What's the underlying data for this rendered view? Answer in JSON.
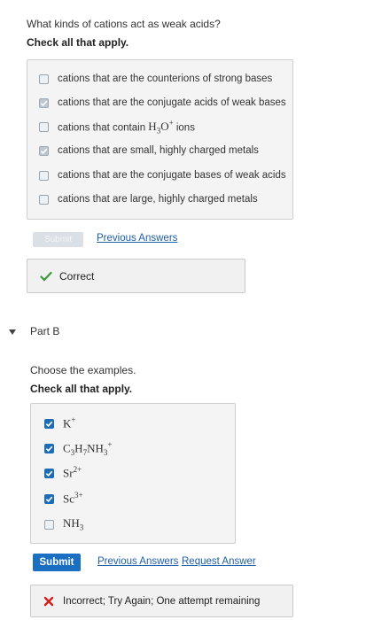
{
  "part_a": {
    "question": "What kinds of cations act as weak acids?",
    "instruction": "Check all that apply.",
    "options": [
      {
        "label": "cations that are the counterions of strong bases",
        "checked": false
      },
      {
        "label": "cations that are the conjugate acids of weak bases",
        "checked": true
      },
      {
        "label_prefix": "cations that contain ",
        "label_formula_main": "H",
        "label_formula_sub": "3",
        "label_formula_main2": "O",
        "label_formula_sup": "+",
        "label_suffix": " ions",
        "checked": false
      },
      {
        "label": "cations that are small, highly charged metals",
        "checked": true
      },
      {
        "label": "cations that are the conjugate bases of weak acids",
        "checked": false
      },
      {
        "label": "cations that are large, highly charged metals",
        "checked": false
      }
    ],
    "submit_label": "Submit",
    "previous_answers_label": "Previous Answers",
    "feedback": "Correct"
  },
  "part_b": {
    "header": "Part B",
    "question": "Choose the examples.",
    "instruction": "Check all that apply.",
    "options": [
      {
        "main": "K",
        "sup": "+",
        "checked": true
      },
      {
        "main": "C",
        "sub1": "3",
        "main2": "H",
        "sub2": "7",
        "main3": "NH",
        "sub3": "3",
        "sup": "+",
        "checked": true
      },
      {
        "main": "Sr",
        "sup": "2+",
        "checked": true
      },
      {
        "main": "Sc",
        "sup": "3+",
        "checked": true
      },
      {
        "main": "NH",
        "sub1": "3",
        "checked": false
      }
    ],
    "submit_label": "Submit",
    "previous_answers_label": "Previous Answers",
    "request_answer_label": "Request Answer",
    "feedback": "Incorrect; Try Again; One attempt remaining"
  },
  "colors": {
    "accent": "#1b6fc2",
    "correct": "#3a9a3a",
    "incorrect": "#d21f1f"
  }
}
